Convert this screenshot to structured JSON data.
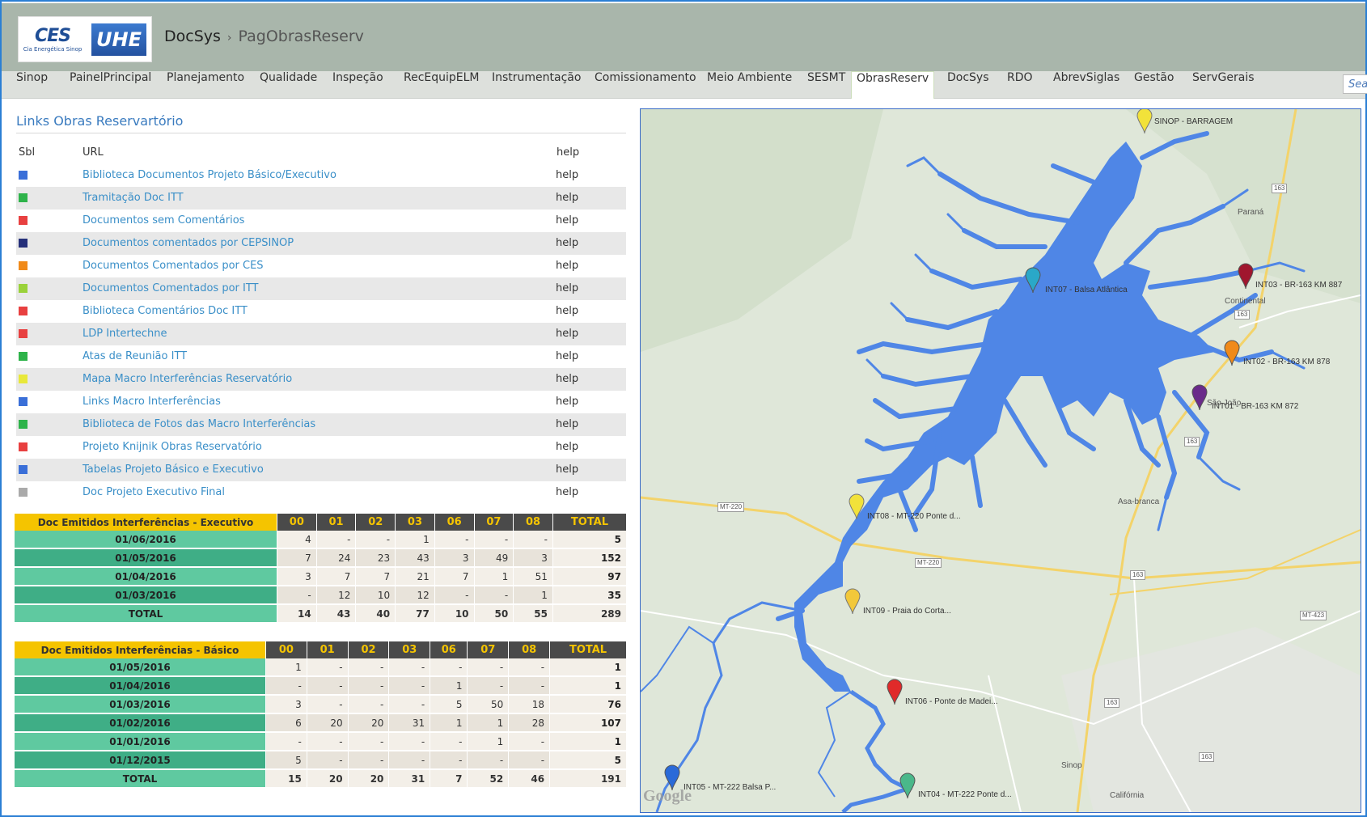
{
  "header": {
    "logo_ces": "CES",
    "logo_ces_sub": "Cia Energética Sinop",
    "logo_uhe": "UHE",
    "crumb_root": "DocSys",
    "crumb_sep": "›",
    "crumb_page": "PagObrasReserv"
  },
  "nav": {
    "items": [
      "Sinop",
      "PainelPrincipal",
      "Planejamento",
      "Qualidade",
      "Inspeção",
      "RecEquipELM",
      "Instrumentação",
      "Comissionamento",
      "Meio Ambiente",
      "SESMT",
      "ObrasReserv",
      "DocSys",
      "RDO",
      "AbrevSiglas",
      "Gestão",
      "ServGerais"
    ],
    "active": "ObrasReserv",
    "search_placeholder": "Search"
  },
  "links": {
    "title": "Links Obras Reservartório",
    "col_sbl": "Sbl",
    "col_url": "URL",
    "col_help": "help",
    "rows": [
      {
        "color": "#3a6fd8",
        "url": "Biblioteca Documentos Projeto Básico/Executivo",
        "help": "help"
      },
      {
        "color": "#2eb34a",
        "url": "Tramitação Doc ITT",
        "help": "help"
      },
      {
        "color": "#e84040",
        "url": "Documentos sem Comentários",
        "help": "help"
      },
      {
        "color": "#25307a",
        "url": "Documentos comentados por CEPSINOP",
        "help": "help"
      },
      {
        "color": "#f08a1a",
        "url": "Documentos Comentados por CES",
        "help": "help"
      },
      {
        "color": "#9ad23a",
        "url": "Documentos Comentados por ITT",
        "help": "help"
      },
      {
        "color": "#e84040",
        "url": "Biblioteca Comentários Doc ITT",
        "help": "help"
      },
      {
        "color": "#e84040",
        "url": "LDP Intertechne",
        "help": "help"
      },
      {
        "color": "#2eb34a",
        "url": "Atas de Reunião ITT",
        "help": "help"
      },
      {
        "color": "#e8e83a",
        "url": "Mapa Macro Interferências Reservatório",
        "help": "help"
      },
      {
        "color": "#3a6fd8",
        "url": "Links Macro Interferências",
        "help": "help"
      },
      {
        "color": "#2eb34a",
        "url": "Biblioteca de Fotos das Macro Interferências",
        "help": "help"
      },
      {
        "color": "#e84040",
        "url": "Projeto Knijnik Obras Reservatório",
        "help": "help"
      },
      {
        "color": "#3a6fd8",
        "url": "Tabelas Projeto Básico e Executivo",
        "help": "help"
      },
      {
        "color": "#aaaaaa",
        "url": "Doc Projeto Executivo Final",
        "help": "help"
      }
    ]
  },
  "table_exec": {
    "title": "Doc Emitidos Interferências - Executivo",
    "codes": [
      "00",
      "01",
      "02",
      "03",
      "06",
      "07",
      "08",
      "TOTAL"
    ],
    "rows": [
      {
        "date": "01/06/2016",
        "vals": [
          "4",
          "-",
          "-",
          "1",
          "-",
          "-",
          "-",
          "5"
        ]
      },
      {
        "date": "01/05/2016",
        "vals": [
          "7",
          "24",
          "23",
          "43",
          "3",
          "49",
          "3",
          "152"
        ]
      },
      {
        "date": "01/04/2016",
        "vals": [
          "3",
          "7",
          "7",
          "21",
          "7",
          "1",
          "51",
          "97"
        ]
      },
      {
        "date": "01/03/2016",
        "vals": [
          "-",
          "12",
          "10",
          "12",
          "-",
          "-",
          "1",
          "35"
        ]
      }
    ],
    "total": {
      "label": "TOTAL",
      "vals": [
        "14",
        "43",
        "40",
        "77",
        "10",
        "50",
        "55",
        "289"
      ]
    }
  },
  "table_basic": {
    "title": "Doc Emitidos Interferências - Básico",
    "codes": [
      "00",
      "01",
      "02",
      "03",
      "06",
      "07",
      "08",
      "TOTAL"
    ],
    "rows": [
      {
        "date": "01/05/2016",
        "vals": [
          "1",
          "-",
          "-",
          "-",
          "-",
          "-",
          "-",
          "1"
        ]
      },
      {
        "date": "01/04/2016",
        "vals": [
          "-",
          "-",
          "-",
          "-",
          "1",
          "-",
          "-",
          "1"
        ]
      },
      {
        "date": "01/03/2016",
        "vals": [
          "3",
          "-",
          "-",
          "-",
          "5",
          "50",
          "18",
          "76"
        ]
      },
      {
        "date": "01/02/2016",
        "vals": [
          "6",
          "20",
          "20",
          "31",
          "1",
          "1",
          "28",
          "107"
        ]
      },
      {
        "date": "01/01/2016",
        "vals": [
          "-",
          "-",
          "-",
          "-",
          "-",
          "1",
          "-",
          "1"
        ]
      },
      {
        "date": "01/12/2015",
        "vals": [
          "5",
          "-",
          "-",
          "-",
          "-",
          "-",
          "-",
          "5"
        ]
      }
    ],
    "total": {
      "label": "TOTAL",
      "vals": [
        "15",
        "20",
        "20",
        "31",
        "7",
        "52",
        "46",
        "191"
      ]
    }
  },
  "map": {
    "pins": [
      {
        "label": "SINOP - BARRAGEM",
        "color": "#f2e23a"
      },
      {
        "label": "INT07 - Balsa Atlântica",
        "color": "#2aa8c8"
      },
      {
        "label": "INT03 - BR-163 KM 887",
        "color": "#a0162e"
      },
      {
        "label": "INT02 - BR-163 KM 878",
        "color": "#f08a1a"
      },
      {
        "label": "INT01 - BR-163 KM 872",
        "color": "#6a2a8a"
      },
      {
        "label": "INT08 - MT-220 Ponte d...",
        "color": "#f2e23a"
      },
      {
        "label": "INT09 - Praia do Corta...",
        "color": "#f2c83a"
      },
      {
        "label": "INT06 - Ponte de Madei...",
        "color": "#e02a2a"
      },
      {
        "label": "INT05 - MT-222 Balsa P...",
        "color": "#2a6ad8"
      },
      {
        "label": "INT04 - MT-222 Ponte d...",
        "color": "#4ab88a"
      }
    ],
    "places": [
      "Paraná",
      "Continental",
      "São João",
      "Asa-branca",
      "Sinop",
      "Califórnia"
    ],
    "shields": [
      "163",
      "163",
      "163",
      "MT-220",
      "MT-220",
      "163",
      "MT-423",
      "163",
      "163"
    ],
    "attribution": "Google"
  }
}
